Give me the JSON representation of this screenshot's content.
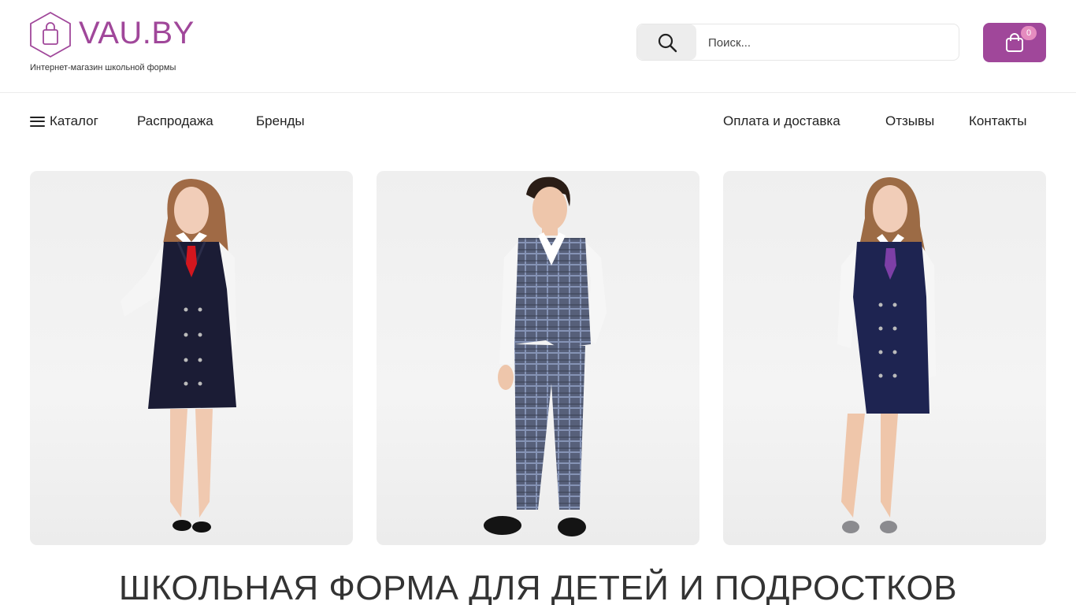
{
  "header": {
    "logo_text": "VAU.BY",
    "tagline": "Интернет-магазин школьной формы",
    "search": {
      "placeholder": "Поиск..."
    },
    "cart": {
      "count": "0"
    }
  },
  "nav": {
    "left": [
      {
        "label": "Каталог"
      },
      {
        "label": "Распродажа"
      },
      {
        "label": "Бренды"
      }
    ],
    "right": [
      {
        "label": "Оплата и доставка"
      },
      {
        "label": "Отзывы"
      },
      {
        "label": "Контакты"
      }
    ]
  },
  "banners": [
    {
      "image": "girl-dark-vest-dress-red-tie"
    },
    {
      "image": "boy-plaid-vest-suit"
    },
    {
      "image": "girl-navy-vest-dress-purple-tie"
    }
  ],
  "page_title": "ШКОЛЬНАЯ ФОРМА ДЛЯ ДЕТЕЙ И ПОДРОСТКОВ",
  "colors": {
    "accent": "#a0479a",
    "badge": "#e58cbf"
  }
}
